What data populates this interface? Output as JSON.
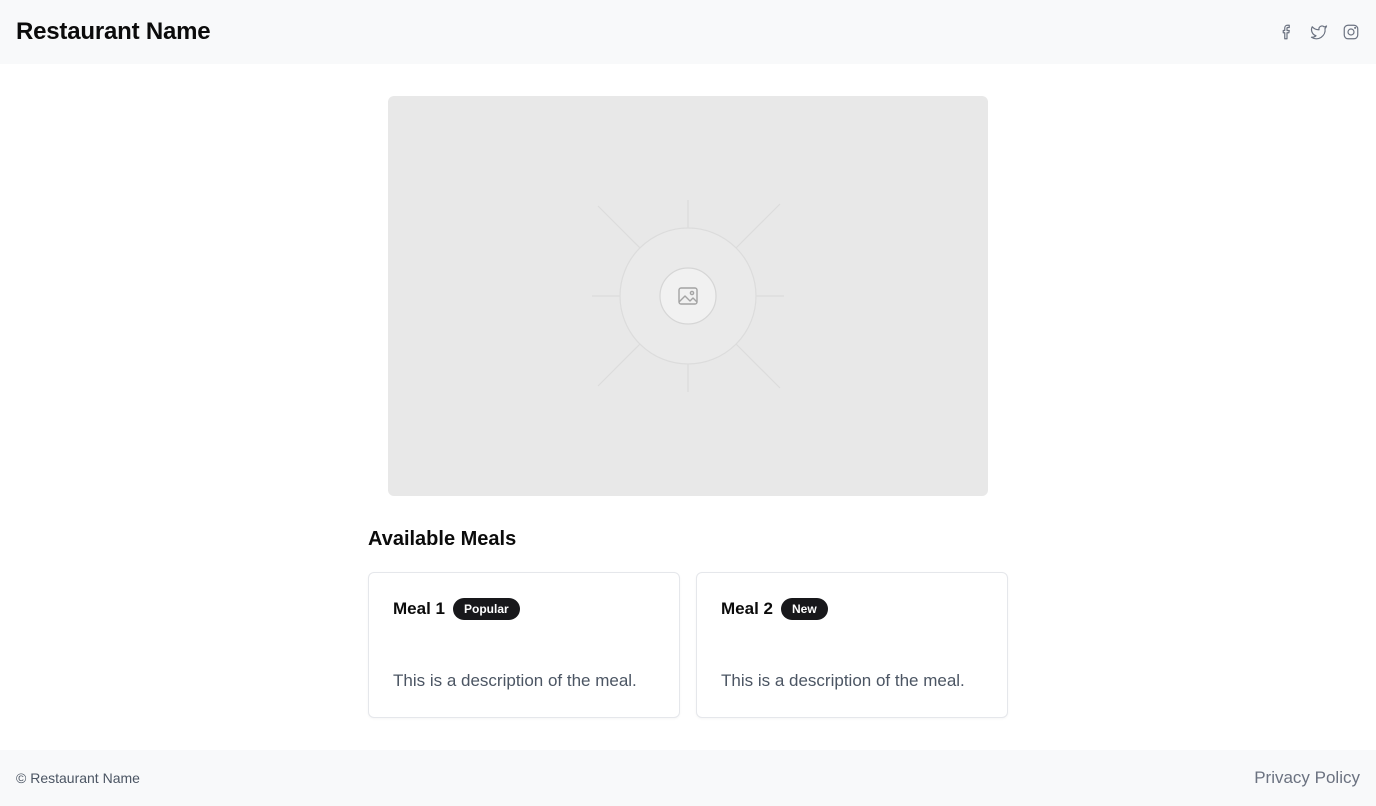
{
  "header": {
    "brand": "Restaurant Name",
    "socials": [
      {
        "icon": "facebook-icon"
      },
      {
        "icon": "twitter-icon"
      },
      {
        "icon": "instagram-icon"
      }
    ]
  },
  "hero": {
    "icon": "image-placeholder-icon"
  },
  "section": {
    "title": "Available Meals"
  },
  "meals": [
    {
      "title": "Meal 1",
      "badge": "Popular",
      "description": "This is a description of the meal."
    },
    {
      "title": "Meal 2",
      "badge": "New",
      "description": "This is a description of the meal."
    }
  ],
  "footer": {
    "copyright": "© Restaurant Name",
    "link": "Privacy Policy"
  },
  "colors": {
    "header_bg": "#f8f9fa",
    "badge_bg": "#18181b",
    "placeholder_bg": "#e8e8e8"
  }
}
